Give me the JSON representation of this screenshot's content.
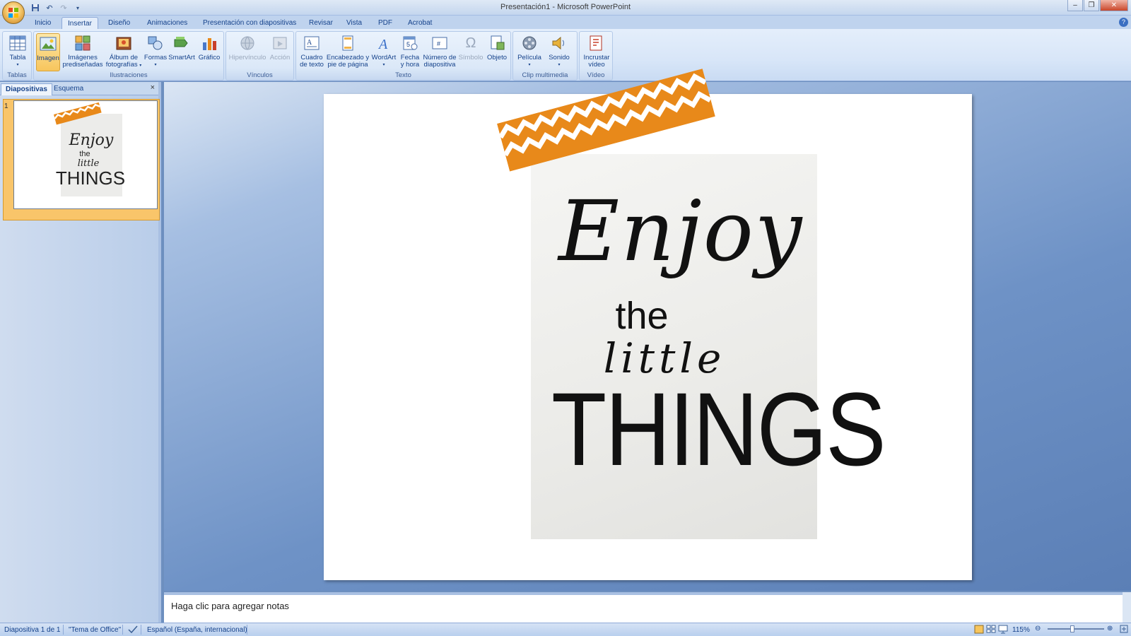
{
  "window": {
    "title": "Presentación1 - Microsoft PowerPoint"
  },
  "tabs": [
    {
      "label": "Inicio"
    },
    {
      "label": "Insertar"
    },
    {
      "label": "Diseño"
    },
    {
      "label": "Animaciones"
    },
    {
      "label": "Presentación con diapositivas"
    },
    {
      "label": "Revisar"
    },
    {
      "label": "Vista"
    },
    {
      "label": "PDF"
    },
    {
      "label": "Acrobat"
    }
  ],
  "ribbon": {
    "groups": {
      "tablas": "Tablas",
      "ilustraciones": "Ilustraciones",
      "vinculos": "Vínculos",
      "texto": "Texto",
      "clip": "Clip multimedia",
      "video": "Vídeo"
    },
    "buttons": {
      "tabla": "Tabla",
      "imagen": "Imagen",
      "imagenes_l1": "Imágenes",
      "imagenes_l2": "prediseñadas",
      "album_l1": "Álbum de",
      "album_l2": "fotografías",
      "formas": "Formas",
      "smartart": "SmartArt",
      "grafico": "Gráfico",
      "hipervinculo": "Hipervínculo",
      "accion": "Acción",
      "cuadro_l1": "Cuadro",
      "cuadro_l2": "de texto",
      "encabezado_l1": "Encabezado y",
      "encabezado_l2": "pie de página",
      "wordart": "WordArt",
      "fecha_l1": "Fecha",
      "fecha_l2": "y hora",
      "numero_l1": "Número de",
      "numero_l2": "diapositiva",
      "simbolo": "Símbolo",
      "objeto": "Objeto",
      "pelicula": "Película",
      "sonido": "Sonido",
      "incrustar_l1": "Incrustar",
      "incrustar_l2": "vídeo"
    }
  },
  "left_pane": {
    "tab_slides": "Diapositivas",
    "tab_outline": "Esquema",
    "close": "×",
    "slide_number": "1"
  },
  "slide": {
    "line1": "Enjoy",
    "line2": "the",
    "line3": "little",
    "line4": "THINGS"
  },
  "notes": {
    "placeholder": "Haga clic para agregar notas"
  },
  "status": {
    "slide": "Diapositiva 1 de 1",
    "theme": "\"Tema de Office\"",
    "language": "Español (España, internacional)",
    "zoom": "115%"
  },
  "colors": {
    "tape_orange": "#e8891a",
    "ribbon_blue": "#15428b",
    "selected_gold": "#f7c55c"
  }
}
